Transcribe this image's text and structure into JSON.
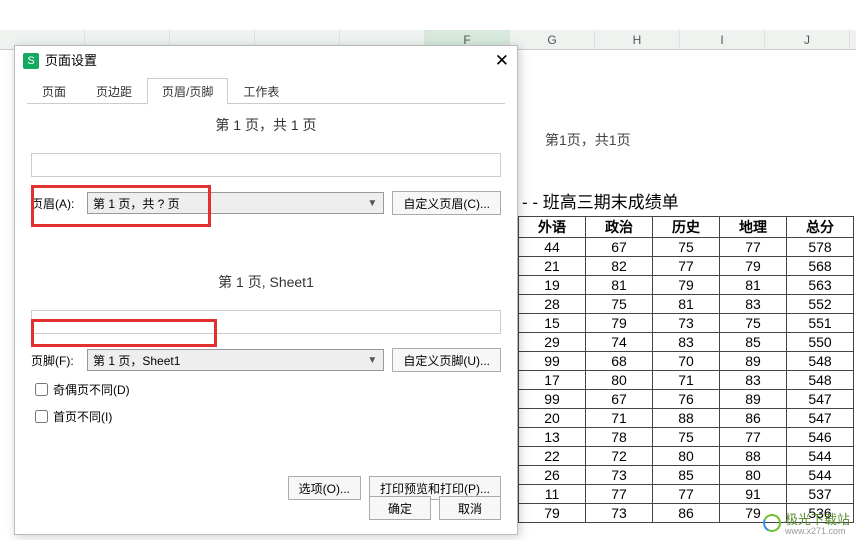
{
  "col_headers": [
    "",
    "",
    "",
    "",
    "",
    "F",
    "G",
    "H",
    "I",
    "J"
  ],
  "page_indicator": "第1页，共1页",
  "data_title": "- - 班高三期末成绩单",
  "table": {
    "headers": [
      "外语",
      "政治",
      "历史",
      "地理",
      "总分"
    ],
    "rows": [
      [
        44,
        67,
        75,
        77,
        578
      ],
      [
        21,
        82,
        77,
        79,
        568
      ],
      [
        19,
        81,
        79,
        81,
        563
      ],
      [
        28,
        75,
        81,
        83,
        552
      ],
      [
        15,
        79,
        73,
        75,
        551
      ],
      [
        29,
        74,
        83,
        85,
        550
      ],
      [
        99,
        68,
        70,
        89,
        548
      ],
      [
        17,
        80,
        71,
        83,
        548
      ],
      [
        99,
        67,
        76,
        89,
        547
      ],
      [
        20,
        71,
        88,
        86,
        547
      ],
      [
        13,
        78,
        75,
        77,
        546
      ],
      [
        22,
        72,
        80,
        88,
        544
      ],
      [
        26,
        73,
        85,
        80,
        544
      ],
      [
        11,
        77,
        77,
        91,
        537
      ],
      [
        79,
        73,
        86,
        79,
        536
      ]
    ]
  },
  "dialog": {
    "title": "页面设置",
    "tabs": {
      "t0": "页面",
      "t1": "页边距",
      "t2": "页眉/页脚",
      "t3": "工作表"
    },
    "header_preview": "第 1 页，共 1 页",
    "footer_preview": "第 1 页, Sheet1",
    "header_label": "页眉(A):",
    "header_value": "第 1 页，共 ? 页",
    "footer_label": "页脚(F):",
    "footer_value": "第 1 页，Sheet1",
    "custom_header_btn": "自定义页眉(C)...",
    "custom_footer_btn": "自定义页脚(U)...",
    "odd_even_diff": "奇偶页不同(D)",
    "first_diff": "首页不同(I)",
    "options_btn": "选项(O)...",
    "print_preview_btn": "打印预览和打印(P)...",
    "ok": "确定",
    "cancel": "取消"
  },
  "watermark": {
    "text": "极光下载站",
    "sub": "www.x271.com"
  }
}
